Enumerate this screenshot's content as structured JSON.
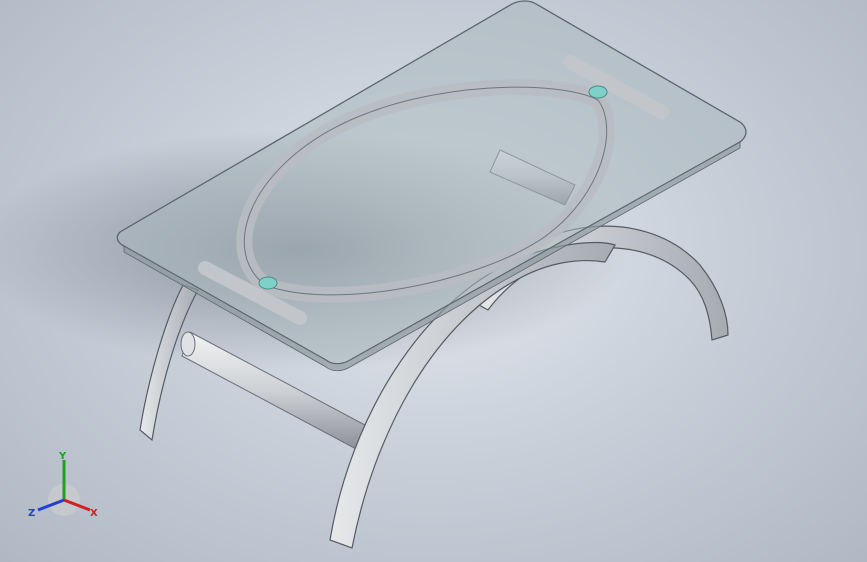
{
  "app": {
    "window_title": ""
  },
  "model": {
    "description_hidden": true,
    "accent_color": "#2a7bd4",
    "glass_color": "#aab8bd",
    "frame_color": "#cfd2d6",
    "pivot_color": "#7fd0c8"
  },
  "triad": {
    "x_label": "X",
    "y_label": "Y",
    "z_label": "Z",
    "x_color": "#d02020",
    "y_color": "#20a020",
    "z_color": "#2040d0"
  }
}
